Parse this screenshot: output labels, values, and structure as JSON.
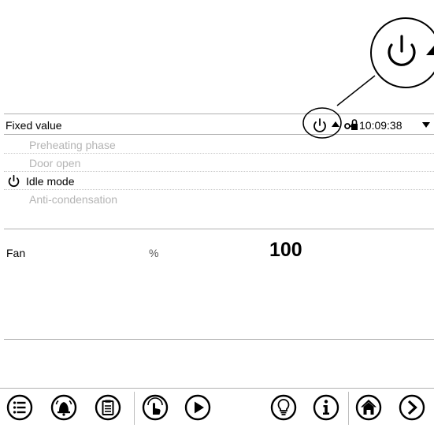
{
  "header": {
    "title": "Fixed value",
    "time": "10:09:38"
  },
  "modes": [
    {
      "label": "Preheating phase",
      "active": false
    },
    {
      "label": "Door open",
      "active": false
    },
    {
      "label": "Idle mode",
      "active": true
    },
    {
      "label": "Anti-condensation",
      "active": false
    }
  ],
  "fan": {
    "name": "Fan",
    "unit": "%",
    "value": "100"
  },
  "toolbar": {
    "buttons": [
      "list-menu-icon",
      "alarm-bell-icon",
      "clipboard-icon",
      "touch-hand-icon",
      "play-icon",
      "lightbulb-icon",
      "info-icon",
      "home-icon",
      "next-arrow-icon"
    ]
  }
}
